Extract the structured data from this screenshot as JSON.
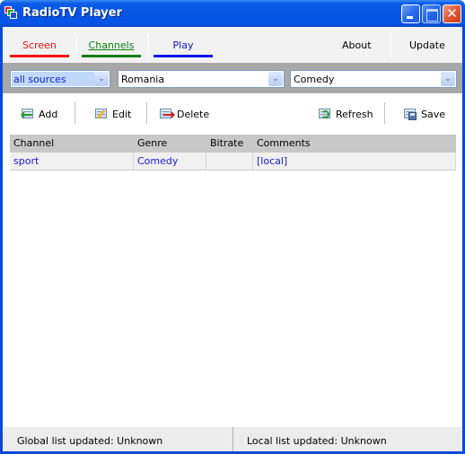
{
  "window": {
    "title": "RadioTV Player",
    "controls": {
      "minimize": "minimize",
      "maximize": "maximize",
      "close": "✕"
    }
  },
  "nav": {
    "tabs": [
      {
        "label": "Screen",
        "color": "#e01010"
      },
      {
        "label": "Channels",
        "color": "#108010",
        "active": true
      },
      {
        "label": "Play",
        "color": "#1010e0"
      }
    ],
    "links": [
      {
        "label": "About"
      },
      {
        "label": "Update"
      }
    ]
  },
  "filters": {
    "source": {
      "value": "all sources"
    },
    "country": {
      "value": "Romania"
    },
    "genre": {
      "value": "Comedy"
    },
    "dropdown_glyph": "⌄"
  },
  "toolbar": {
    "add_label": "Add",
    "edit_label": "Edit",
    "delete_label": "Delete",
    "refresh_label": "Refresh",
    "save_label": "Save"
  },
  "table": {
    "columns": [
      "Channel",
      "Genre",
      "Bitrate",
      "Comments"
    ],
    "rows": [
      {
        "channel": "sport",
        "genre": "Comedy",
        "bitrate": "",
        "comments": "[local]"
      }
    ]
  },
  "status": {
    "global": "Global list updated: Unknown",
    "local": "Local list updated: Unknown"
  }
}
